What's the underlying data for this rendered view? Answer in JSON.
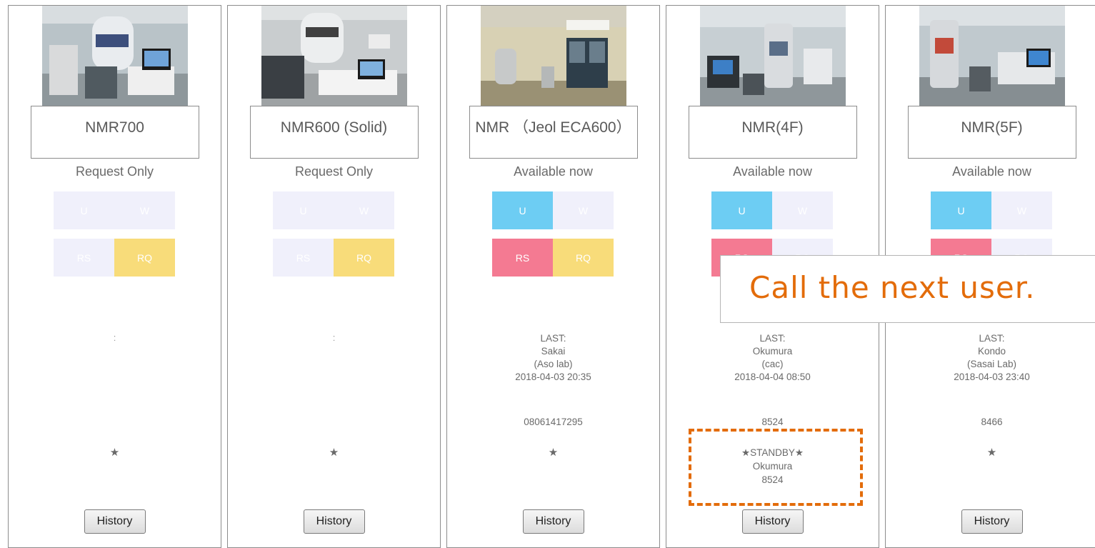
{
  "instruments": [
    {
      "name": "NMR700",
      "status": "Request Only",
      "tiles": {
        "u": "U",
        "w": "W",
        "rs": "RS",
        "rq": "RQ"
      },
      "active": [
        "rq"
      ],
      "separator": ":",
      "star": "★",
      "history_label": "History"
    },
    {
      "name": "NMR600 (Solid)",
      "status": "Request Only",
      "tiles": {
        "u": "U",
        "w": "W",
        "rs": "RS",
        "rq": "RQ"
      },
      "active": [
        "rq"
      ],
      "separator": ":",
      "star": "★",
      "history_label": "History"
    },
    {
      "name": "NMR （Jeol ECA600）",
      "status": "Available now",
      "tiles": {
        "u": "U",
        "w": "W",
        "rs": "RS",
        "rq": "RQ"
      },
      "active": [
        "u",
        "rs",
        "rq"
      ],
      "last": {
        "label": "LAST:",
        "user": "Sakai",
        "lab": "(Aso lab)",
        "time": "2018-04-03 20:35"
      },
      "phone": "08061417295",
      "star": "★",
      "history_label": "History"
    },
    {
      "name": "NMR(4F)",
      "status": "Available now",
      "tiles": {
        "u": "U",
        "w": "W",
        "rs": "RS",
        "rq": "RQ"
      },
      "active": [
        "u",
        "rs"
      ],
      "last": {
        "label": "LAST:",
        "user": "Okumura",
        "lab": "(cac)",
        "time": "2018-04-04 08:50"
      },
      "phone": "8524",
      "standby": {
        "title": "★STANDBY★",
        "user": "Okumura",
        "phone": "8524"
      },
      "history_label": "History"
    },
    {
      "name": "NMR(5F)",
      "status": "Available now",
      "tiles": {
        "u": "U",
        "w": "W",
        "rs": "RS",
        "rq": "RQ"
      },
      "active": [
        "u",
        "rs"
      ],
      "last": {
        "label": "LAST:",
        "user": "Kondo",
        "lab": "(Sasai Lab)",
        "time": "2018-04-03 23:40"
      },
      "phone": "8466",
      "star": "★",
      "history_label": "History"
    }
  ],
  "callout": "Call the next user.",
  "colors": {
    "u": "#6dcdf3",
    "rs": "#f47a92",
    "rq": "#f8dc7a",
    "inactive": "#f0f0fb",
    "accent": "#e36c0a"
  }
}
